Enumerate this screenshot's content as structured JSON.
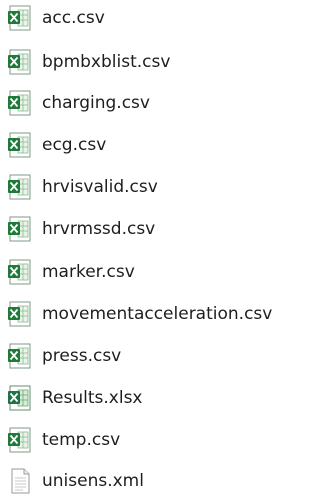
{
  "files": [
    {
      "name": "acc.csv",
      "icon": "excel-csv-icon"
    },
    {
      "name": "bpmbxblist.csv",
      "icon": "excel-csv-icon"
    },
    {
      "name": "charging.csv",
      "icon": "excel-csv-icon"
    },
    {
      "name": "ecg.csv",
      "icon": "excel-csv-icon"
    },
    {
      "name": "hrvisvalid.csv",
      "icon": "excel-csv-icon"
    },
    {
      "name": "hrvrmssd.csv",
      "icon": "excel-csv-icon"
    },
    {
      "name": "marker.csv",
      "icon": "excel-csv-icon"
    },
    {
      "name": "movementacceleration.csv",
      "icon": "excel-csv-icon"
    },
    {
      "name": "press.csv",
      "icon": "excel-csv-icon"
    },
    {
      "name": "Results.xlsx",
      "icon": "excel-workbook-icon"
    },
    {
      "name": "temp.csv",
      "icon": "excel-csv-icon"
    },
    {
      "name": "unisens.xml",
      "icon": "xml-document-icon"
    }
  ],
  "colors": {
    "excel_green": "#1f7a3a",
    "excel_light": "#d9efd9",
    "document_border": "#9a9a9a",
    "text": "#1e1e1e"
  }
}
